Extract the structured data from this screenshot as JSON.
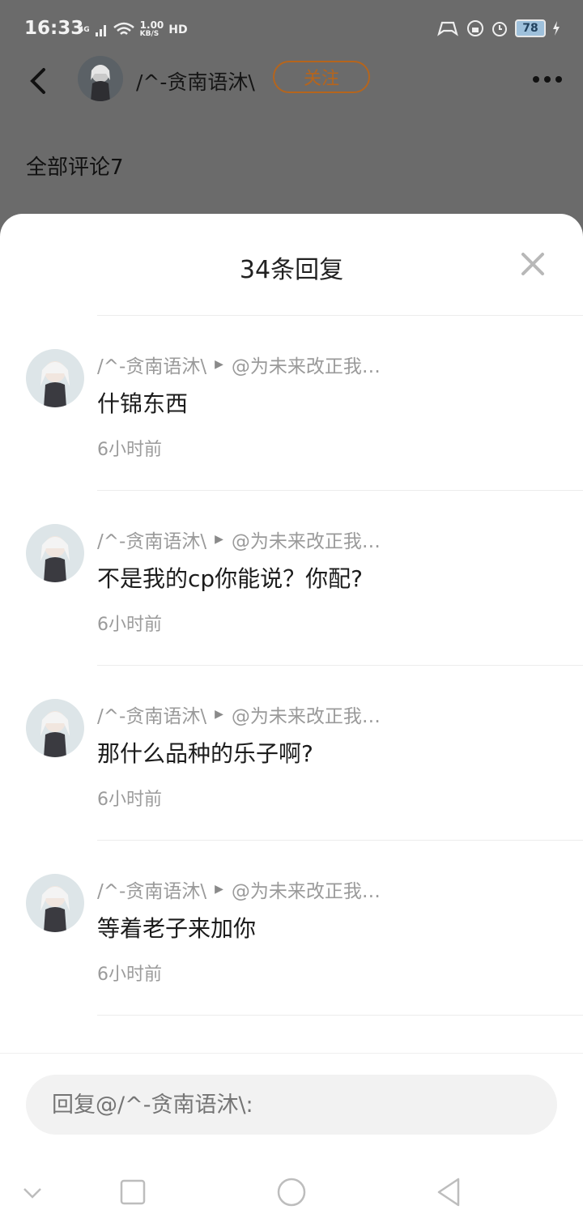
{
  "status": {
    "time": "16:33",
    "network": "4G",
    "speed_value": "1.00",
    "speed_unit": "KB/S",
    "hd": "HD",
    "battery": "78"
  },
  "header": {
    "username": "/^-贪南语沐\\",
    "follow_label": "关注"
  },
  "comments_title": "全部评论7",
  "sheet": {
    "title": "34条回复"
  },
  "replies": [
    {
      "author": "/^-贪南语沐\\",
      "target": "@为未来改正我…",
      "text": "什锦东西",
      "time": "6小时前"
    },
    {
      "author": "/^-贪南语沐\\",
      "target": "@为未来改正我…",
      "text": "不是我的cp你能说？你配?",
      "time": "6小时前"
    },
    {
      "author": "/^-贪南语沐\\",
      "target": "@为未来改正我…",
      "text": "那什么品种的乐子啊?",
      "time": "6小时前"
    },
    {
      "author": "/^-贪南语沐\\",
      "target": "@为未来改正我…",
      "text": "等着老子来加你",
      "time": "6小时前"
    }
  ],
  "reply_input": {
    "placeholder": "回复@/^-贪南语沐\\:"
  },
  "colors": {
    "follow": "#b5651d",
    "dim_overlay": "#6b6b6b",
    "sheet_bg": "#ffffff"
  }
}
